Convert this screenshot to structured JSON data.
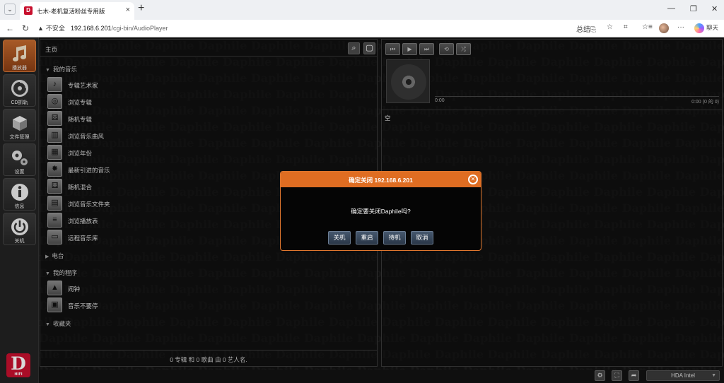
{
  "browser": {
    "tab_title": "七木-老机复活粉丝专用版",
    "tab_favicon": "D",
    "new_tab_glyph": "+",
    "insecure_label": "不安全",
    "url_host": "192.168.6.201",
    "url_path": "/cgi-bin/AudioPlayer",
    "summarize_label": "总结",
    "chat_label": "聊天",
    "colors": {
      "tab_bg": "#ffffff",
      "strip_bg": "#eef0f3"
    }
  },
  "sidebar": {
    "items": [
      {
        "label": "播放器",
        "icon": "music-note-icon"
      },
      {
        "label": "CD抓轨",
        "icon": "cd-icon"
      },
      {
        "label": "文件管理",
        "icon": "box-icon"
      },
      {
        "label": "设置",
        "icon": "gears-icon"
      },
      {
        "label": "信息",
        "icon": "info-icon"
      },
      {
        "label": "关机",
        "icon": "power-icon"
      }
    ],
    "logo_letter": "D",
    "logo_subtext": "HIFI",
    "colors": {
      "active": "#c56a2e",
      "logo": "#c8102e"
    }
  },
  "watermark_text": "Daphile",
  "library": {
    "home": "主页",
    "sections": {
      "my_music": "我的音乐",
      "radio": "电台",
      "my_programs": "我的程序",
      "favorites": "收藏夹"
    },
    "music_items": [
      "专辑艺术家",
      "浏览专辑",
      "随机专辑",
      "浏览音乐曲风",
      "浏览年份",
      "最新引进的音乐",
      "随机混合",
      "浏览音乐文件夹",
      "浏览播放表",
      "远程音乐库"
    ],
    "program_items": [
      "闹钟",
      "音乐不要停"
    ],
    "footer": "0 专辑 和 0 歌曲 由 0 艺人名."
  },
  "player": {
    "time_start": "0:00",
    "time_end": "0:00 (0 的 0)",
    "playlist_empty": "空"
  },
  "status": {
    "device": "HDA Intel"
  },
  "dialog": {
    "title": "确定关闭 192.168.6.201",
    "message": "确定要关闭Daphile吗?",
    "buttons": {
      "shutdown": "关机",
      "restart": "重启",
      "standby": "待机",
      "cancel": "取消"
    },
    "colors": {
      "header": "#df6d22",
      "border": "#e0772e",
      "button": "#3a4a5e"
    }
  }
}
